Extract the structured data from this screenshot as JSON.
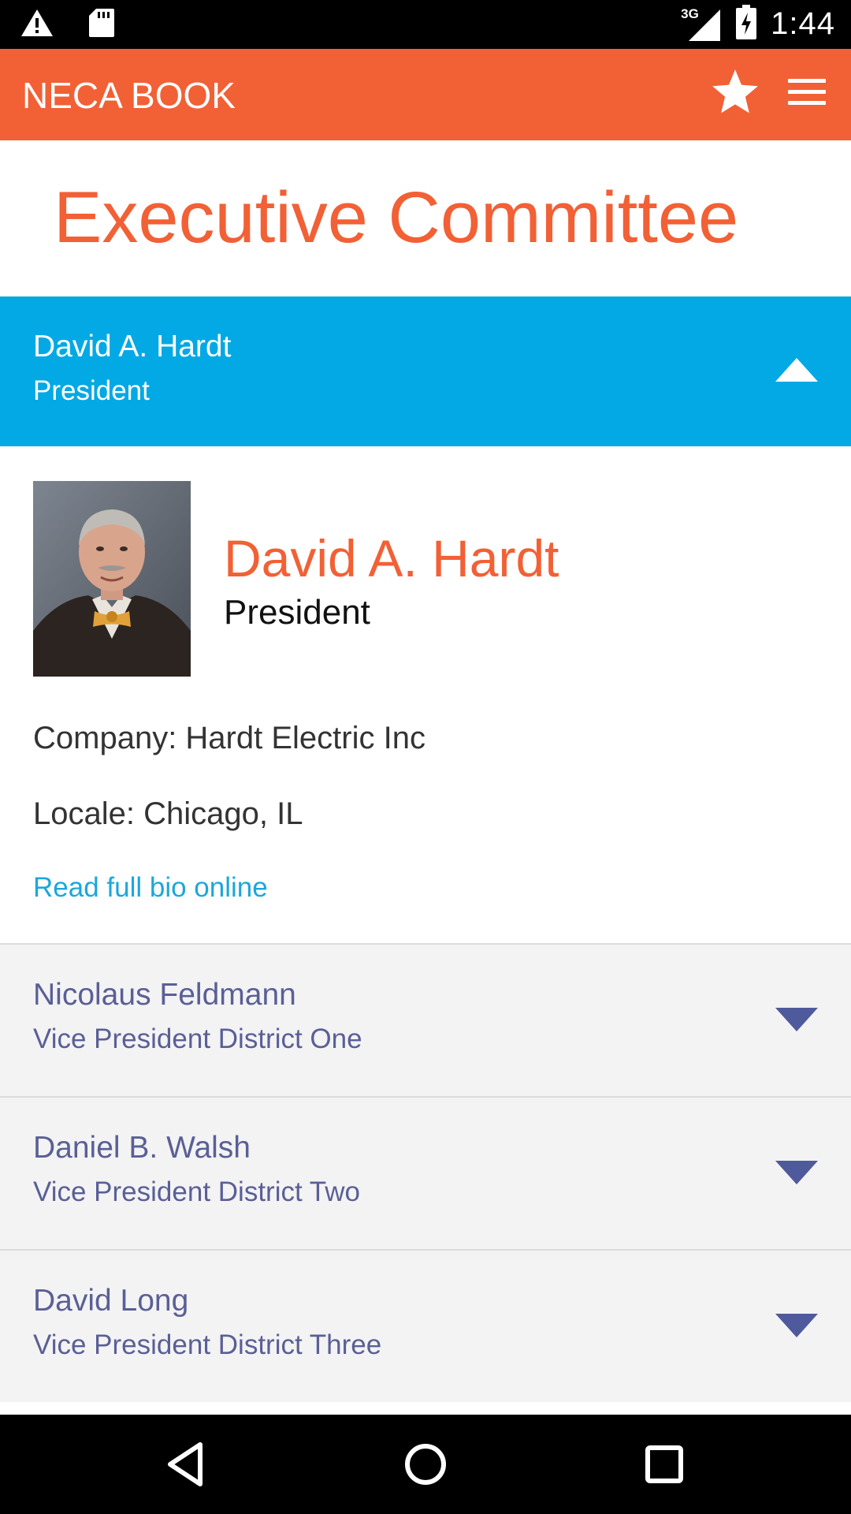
{
  "status_bar": {
    "time": "1:44",
    "network": "3G",
    "icons": [
      "warning-icon",
      "sd-card-icon",
      "signal-icon",
      "battery-charging-icon"
    ]
  },
  "app_bar": {
    "title": "NECA BOOK",
    "icons": [
      "star-icon",
      "menu-icon"
    ],
    "color": "#f26035"
  },
  "page": {
    "title": "Executive Committee"
  },
  "expanded_member": {
    "name": "David A. Hardt",
    "role": "President",
    "company": "Company: Hardt Electric Inc",
    "locale": "Locale: Chicago, IL",
    "bio_link": "Read full bio online",
    "header_color": "#03a9e4"
  },
  "members": [
    {
      "name": "Nicolaus Feldmann",
      "role": "Vice President District One"
    },
    {
      "name": "Daniel B. Walsh",
      "role": "Vice President District Two"
    },
    {
      "name": "David Long",
      "role": "Vice President District Three"
    }
  ],
  "nav_bar": {
    "icons": [
      "back-icon",
      "home-icon",
      "recents-icon"
    ]
  }
}
